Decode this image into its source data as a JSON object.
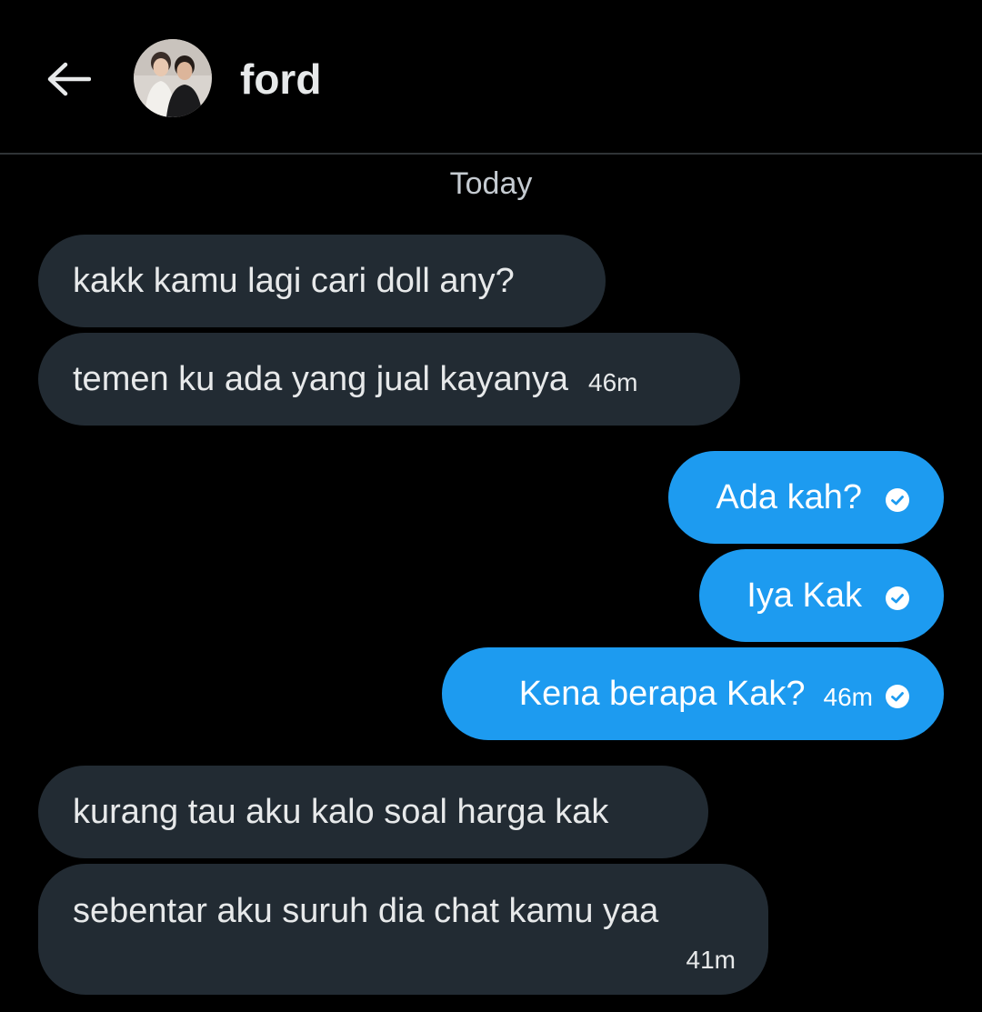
{
  "header": {
    "back_icon": "arrow-left-icon",
    "contact_name": "ford"
  },
  "date_separator": "Today",
  "messages": [
    {
      "direction": "incoming",
      "text": "kakk kamu lagi cari doll any?",
      "time": ""
    },
    {
      "direction": "incoming",
      "text": "temen ku ada yang jual kayanya",
      "time": "46m"
    },
    {
      "direction": "outgoing",
      "text": "Ada kah?",
      "time": "",
      "read": true
    },
    {
      "direction": "outgoing",
      "text": "Iya Kak",
      "time": "",
      "read": true
    },
    {
      "direction": "outgoing",
      "text": "Kena berapa Kak?",
      "time": "46m",
      "read": true
    },
    {
      "direction": "incoming",
      "text": "kurang tau aku kalo soal harga kak",
      "time": ""
    },
    {
      "direction": "incoming",
      "text": "sebentar aku suruh dia chat kamu yaa",
      "time": "41m"
    }
  ],
  "colors": {
    "background": "#000000",
    "incoming_bubble": "#222b33",
    "outgoing_bubble": "#1d9bf0",
    "text": "#e7e9ea",
    "divider": "#2f3336"
  }
}
